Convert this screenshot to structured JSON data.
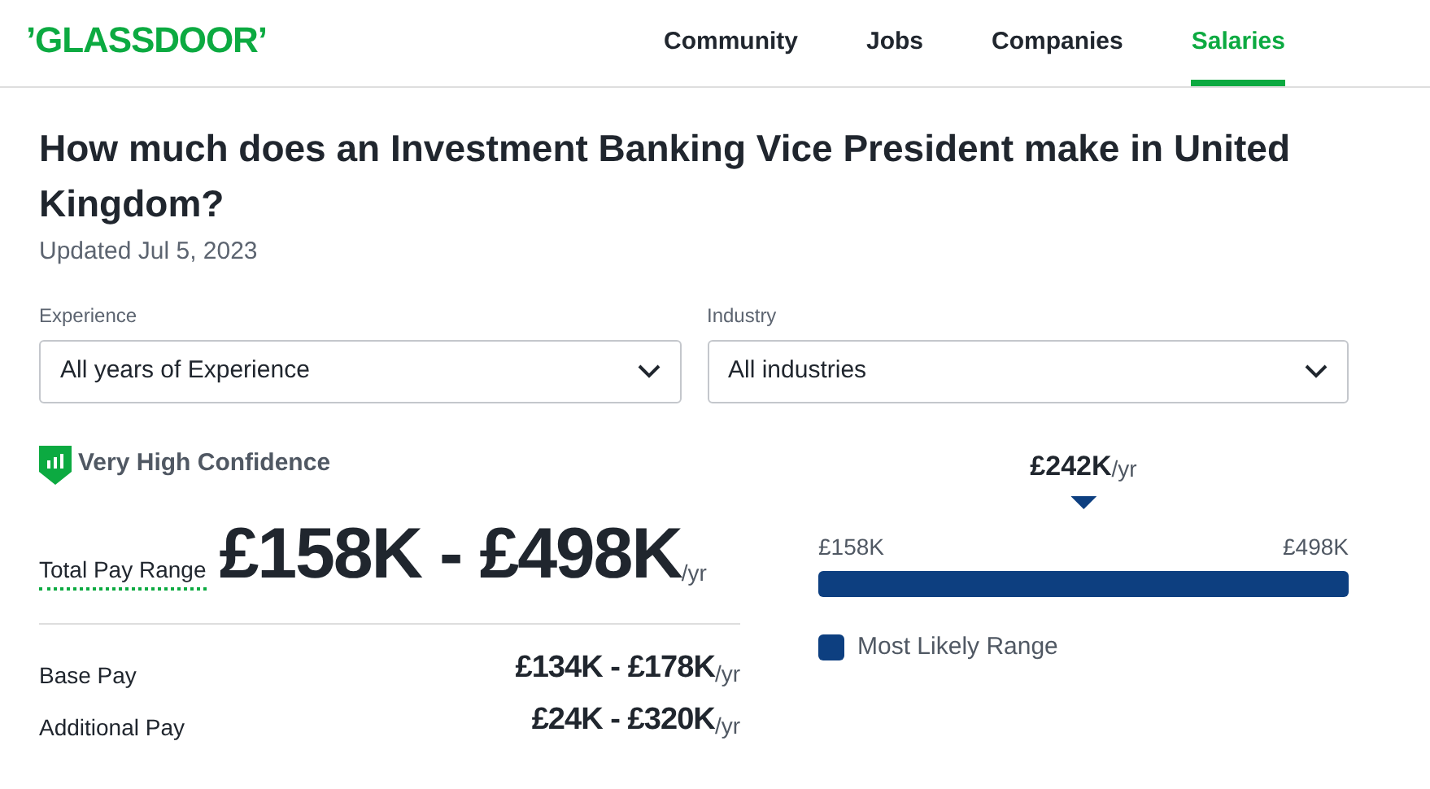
{
  "header": {
    "logo": "ʼGLASSDOORʼ",
    "nav": [
      {
        "label": "Community",
        "selected": false
      },
      {
        "label": "Jobs",
        "selected": false
      },
      {
        "label": "Companies",
        "selected": false
      },
      {
        "label": "Salaries",
        "selected": true
      }
    ]
  },
  "title": "How much does an Investment Banking Vice President make in United Kingdom?",
  "updated": "Updated Jul 5, 2023",
  "filters": [
    {
      "label": "Experience",
      "value": "All years of Experience"
    },
    {
      "label": "Industry",
      "value": "All industries"
    }
  ],
  "confidence": "Very High Confidence",
  "total": {
    "label": "Total Pay Range",
    "value": "£158K - £498K",
    "unit": "/yr"
  },
  "breakdown": [
    {
      "label": "Base Pay",
      "value": "£134K - £178K",
      "unit": "/yr"
    },
    {
      "label": "Additional Pay",
      "value": "£24K - £320K",
      "unit": "/yr"
    }
  ],
  "range": {
    "median": "£242K",
    "unit": "/yr",
    "low": "£158K",
    "high": "£498K",
    "legend": "Most Likely Range"
  }
}
